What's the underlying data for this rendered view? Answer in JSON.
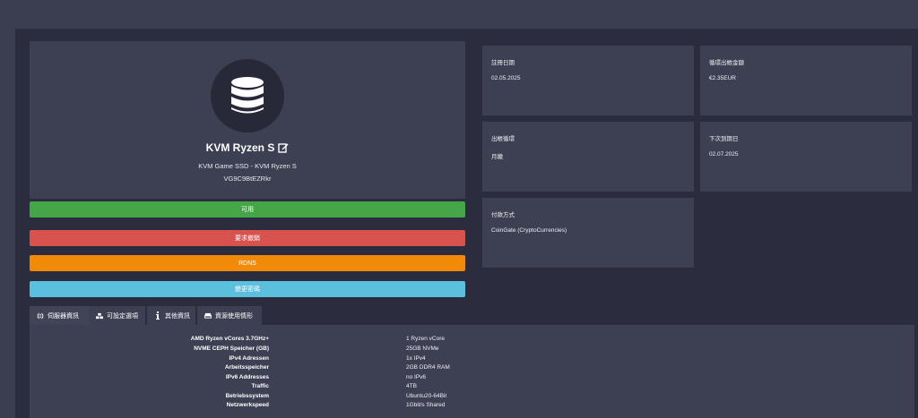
{
  "product": {
    "title": "KVM Ryzen S",
    "subtitle": "KVM Game SSD - KVM Ryzen S",
    "service_id": "VG9C9BtEZRkr",
    "icon": "database-icon",
    "edit_icon": "edit-icon"
  },
  "buttons": {
    "status": "可用",
    "cancel": "要求撤銷",
    "rdns": "RDNS",
    "change_password": "變更密碼"
  },
  "colors": {
    "status": "#45a648",
    "cancel": "#d8524e",
    "rdns": "#f08a08",
    "change_password": "#5bbfde"
  },
  "info": {
    "register_date_label": "註冊日期",
    "register_date_value": "02.05.2025",
    "recurring_amount_label": "循環出帳金額",
    "recurring_amount_value": "€2.35EUR",
    "billing_cycle_label": "出帳循環",
    "billing_cycle_value": "月繳",
    "next_due_label": "下次到期日",
    "next_due_value": "02.07.2025",
    "payment_method_label": "付款方式",
    "payment_method_value": "CoinGate (CryptoCurrencies)"
  },
  "tabs": [
    {
      "label": "伺服器資訊",
      "icon": "globe-icon"
    },
    {
      "label": "可設定選項",
      "icon": "cubes-icon"
    },
    {
      "label": "其他資訊",
      "icon": "info-icon"
    },
    {
      "label": "資源使用情形",
      "icon": "hdd-icon"
    }
  ],
  "specs": [
    {
      "label": "AMD Ryzen vCores 3.7GHz+",
      "value": "1 Ryzen vCore"
    },
    {
      "label": "NVME CEPH Speicher (GB)",
      "value": "25GB NVMe"
    },
    {
      "label": "IPv4 Adressen",
      "value": "1x IPv4"
    },
    {
      "label": "Arbeitsspeicher",
      "value": "2GB DDR4 RAM"
    },
    {
      "label": "IPv6 Addresses",
      "value": "no IPv6"
    },
    {
      "label": "Traffic",
      "value": "4TB"
    },
    {
      "label": "Betriebssystem",
      "value": "Ubuntu20-64Bit"
    },
    {
      "label": "Netzwerkspeed",
      "value": "1Gbit/s Shared"
    }
  ]
}
